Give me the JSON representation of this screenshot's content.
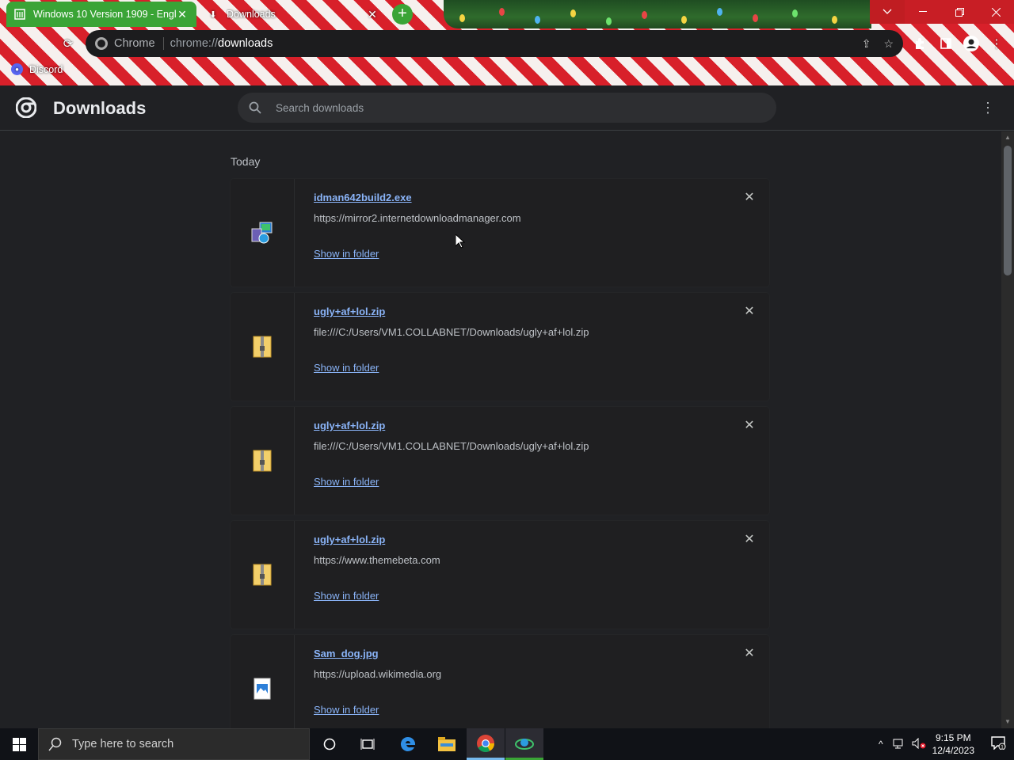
{
  "window": {
    "tabs": [
      {
        "title": "Windows 10 Version 1909 - Engl",
        "active": true
      },
      {
        "title": "Downloads",
        "active": false
      }
    ]
  },
  "omnibox": {
    "chip": "Chrome",
    "scheme": "chrome://",
    "path": "downloads"
  },
  "bookmarks": [
    {
      "label": "Discord"
    }
  ],
  "header": {
    "title": "Downloads",
    "search_placeholder": "Search downloads"
  },
  "section": {
    "label": "Today"
  },
  "downloads": [
    {
      "file": "idman642build2.exe",
      "url": "https://mirror2.internetdownloadmanager.com",
      "action": "Show in folder",
      "icon": "installer-icon"
    },
    {
      "file": "ugly+af+lol.zip",
      "url": "file:///C:/Users/VM1.COLLABNET/Downloads/ugly+af+lol.zip",
      "action": "Show in folder",
      "icon": "zip-folder-icon"
    },
    {
      "file": "ugly+af+lol.zip",
      "url": "file:///C:/Users/VM1.COLLABNET/Downloads/ugly+af+lol.zip",
      "action": "Show in folder",
      "icon": "zip-folder-icon"
    },
    {
      "file": "ugly+af+lol.zip",
      "url": "https://www.themebeta.com",
      "action": "Show in folder",
      "icon": "zip-folder-icon"
    },
    {
      "file": "Sam_dog.jpg",
      "url": "https://upload.wikimedia.org",
      "action": "Show in folder",
      "icon": "image-file-icon"
    }
  ],
  "taskbar": {
    "search_placeholder": "Type here to search",
    "time": "9:15 PM",
    "date": "12/4/2023",
    "notification_count": "1"
  },
  "colors": {
    "theme_red": "#d8202a",
    "tab_green": "#3aa436",
    "link": "#8ab4f8",
    "page_bg": "#202124"
  }
}
